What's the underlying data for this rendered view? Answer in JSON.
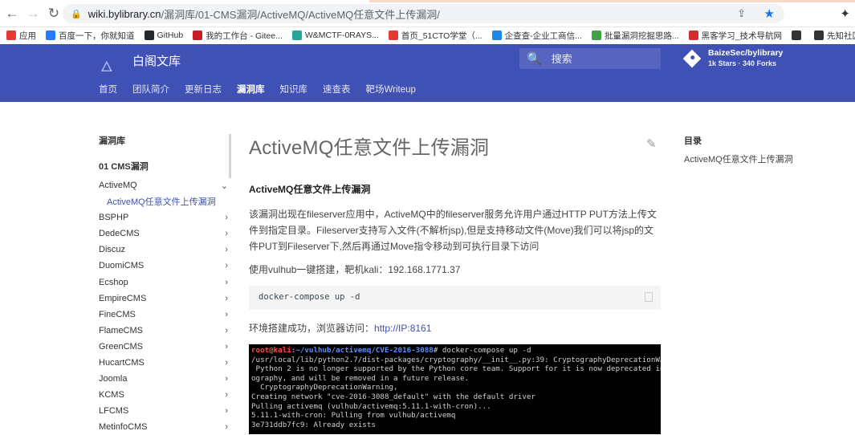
{
  "browser": {
    "url_host": "wiki.bylibrary.cn",
    "url_path": "/漏洞库/01-CMS漏洞/ActiveMQ/ActiveMQ任意文件上传漏洞/",
    "bookmarks": [
      {
        "label": "应用",
        "icon": "apps-icon",
        "color": "#e53935"
      },
      {
        "label": "百度一下，你就知道",
        "icon": "baidu-icon",
        "color": "#2979ff"
      },
      {
        "label": "GitHub",
        "icon": "github-icon",
        "color": "#24292e"
      },
      {
        "label": "我的工作台 - Gitee...",
        "icon": "gitee-icon",
        "color": "#c71d23"
      },
      {
        "label": "W&MCTF-0RAYS...",
        "icon": "document-icon",
        "color": "#26a69a"
      },
      {
        "label": "首页_51CTO学堂（...",
        "icon": "51cto-icon",
        "color": "#e53935"
      },
      {
        "label": "企查查-企业工商信...",
        "icon": "qichacha-icon",
        "color": "#1e88e5"
      },
      {
        "label": "批量漏洞挖掘思路...",
        "icon": "note-icon",
        "color": "#43a047"
      },
      {
        "label": "黑客学习_技术导航网",
        "icon": "heart-icon",
        "color": "#d32f2f"
      },
      {
        "label": "",
        "icon": "globe-icon",
        "color": "#333333"
      },
      {
        "label": "先知社区",
        "icon": "xianzhi-icon",
        "color": "#333333"
      },
      {
        "label": "GitHub - xiao",
        "icon": "github-icon",
        "color": "#24292e"
      }
    ]
  },
  "header": {
    "site_title": "白阁文库",
    "search_placeholder": "搜索",
    "repo_name": "BaizeSec/bylibrary",
    "repo_facts": "1k Stars · 340 Forks",
    "tabs": [
      "首页",
      "团队简介",
      "更新日志",
      "漏洞库",
      "知识库",
      "速查表",
      "靶场Writeup"
    ],
    "active_tab": "漏洞库",
    "header_color": "#3f51b5"
  },
  "sidebar": {
    "title": "漏洞库",
    "section": "01 CMS漏洞",
    "active_item": "ActiveMQ",
    "active_subitem": "ActiveMQ任意文件上传漏洞",
    "items": [
      "ActiveMQ",
      "BSPHP",
      "DedeCMS",
      "Discuz",
      "DuomiCMS",
      "Ecshop",
      "EmpireCMS",
      "FineCMS",
      "FlameCMS",
      "GreenCMS",
      "HucartCMS",
      "Joomla",
      "KCMS",
      "LFCMS",
      "MetinfoCMS"
    ]
  },
  "article": {
    "title": "ActiveMQ任意文件上传漏洞",
    "heading": "ActiveMQ任意文件上传漏洞",
    "paragraph": "该漏洞出现在fileserver应用中，ActiveMQ中的fileserver服务允许用户通过HTTP PUT方法上传文件到指定目录。Fileserver支持写入文件(不解析jsp),但是支持移动文件(Move)我们可以将jsp的文件PUT到Fileserver下,然后再通过Move指令移动到可执行目录下访问",
    "setup_text": "使用vulhub一键搭建，靶机kali：192.168.1771.37",
    "code": "docker-compose up -d",
    "success_prefix": "环境搭建成功，浏览器访问：",
    "success_link": "http://IP:8161",
    "terminal": {
      "prompt_user": "root@kali",
      "prompt_path": ":~/vulhub/activemq/CVE-2016-3088",
      "command": "# docker-compose up -d",
      "lines": [
        "/usr/local/lib/python2.7/dist-packages/cryptography/__init__.py:39: CryptographyDeprecationWa",
        " Python 2 is no longer supported by the Python core team. Support for it is now deprecated in",
        "ography, and will be removed in a future release.",
        "  CryptographyDeprecationWarning,",
        "Creating network \"cve-2016-3088_default\" with the default driver",
        "Pulling activemq (vulhub/activemq:5.11.1-with-cron)...",
        "5.11.1-with-cron: Pulling from vulhub/activemq",
        "3e731ddb7fc9: Already exists"
      ]
    }
  },
  "toc": {
    "title": "目录",
    "items": [
      "ActiveMQ任意文件上传漏洞"
    ]
  }
}
